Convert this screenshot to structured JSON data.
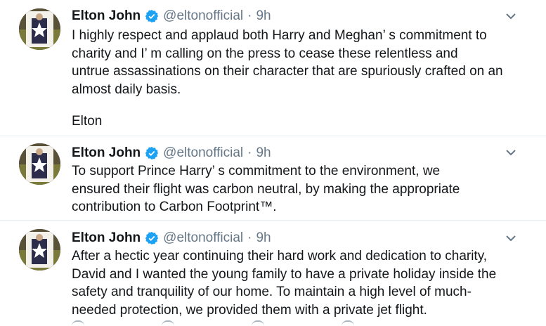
{
  "tweets": [
    {
      "author": "Elton John",
      "handle": "@eltonofficial",
      "separator": "·",
      "time": "9h",
      "text": "I highly respect and applaud both Harry and Meghan’ s commitment to\ncharity and I’ m calling on the press to cease these relentless and\nuntrue assassinations on their character that are spuriously crafted on an\nalmost daily basis.",
      "signoff": "Elton"
    },
    {
      "author": "Elton John",
      "handle": "@eltonofficial",
      "separator": "·",
      "time": "9h",
      "text": "To support Prince Harry’ s commitment to the environment, we\nensured their flight was carbon neutral, by making the appropriate\ncontribution to Carbon Footprint™."
    },
    {
      "author": "Elton John",
      "handle": "@eltonofficial",
      "separator": "·",
      "time": "9h",
      "text": "After a hectic year continuing their hard work and dedication to charity,\nDavid and I wanted the young family to have a private holiday inside the\nsafety and tranquility of our home. To maintain a high level of much-\nneeded protection, we provided them with a private jet flight."
    }
  ],
  "colors": {
    "verified": "#1da1f2",
    "muted": "#657786",
    "text": "#14171a",
    "divider": "#e6ecf0"
  },
  "icons": {
    "verified": "verified-badge-icon",
    "menu": "chevron-down-icon"
  }
}
